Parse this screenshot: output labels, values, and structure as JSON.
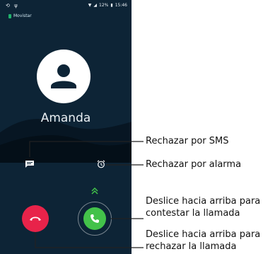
{
  "status_bar": {
    "left_icons": [
      "signal-loop-icon",
      "usb-icon"
    ],
    "battery": "12%",
    "time": "15:46"
  },
  "carrier": "Movistar",
  "caller_name": "Amanda",
  "annotations": {
    "sms_reject": "Rechazar por SMS",
    "alarm_reject": "Rechazar por alarma",
    "answer_line1": "Deslice hacia arriba para",
    "answer_line2": "contestar la llamada",
    "reject_line1": "Deslice hacia arriba para",
    "reject_line2": "rechazar la llamada"
  },
  "colors": {
    "background": "#0d2436",
    "reject": "#e8234a",
    "answer": "#43c24a",
    "accent": "#1fb26b"
  }
}
